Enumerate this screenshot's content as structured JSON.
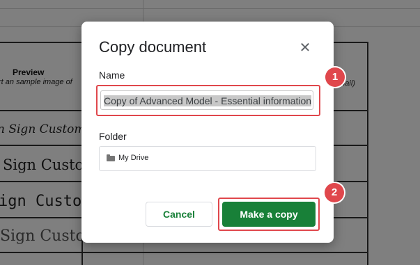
{
  "background": {
    "preview_title": "Preview",
    "preview_subtitle": "rt an sample image of",
    "right_fragment": "email)",
    "sign_rows": [
      "n Sign Customise",
      "Sign Customise",
      "ign Custom",
      "Sign Custom"
    ]
  },
  "dialog": {
    "title": "Copy document",
    "close_icon": "close-icon",
    "name_label": "Name",
    "name_value": "Copy of Advanced Model - Essential information",
    "folder_label": "Folder",
    "folder_icon": "folder-icon",
    "folder_value": "My Drive",
    "cancel_label": "Cancel",
    "copy_label": "Make a copy",
    "accent_color": "#188038"
  },
  "annotations": {
    "badge1": "1",
    "badge2": "2",
    "color": "#e0474c"
  }
}
